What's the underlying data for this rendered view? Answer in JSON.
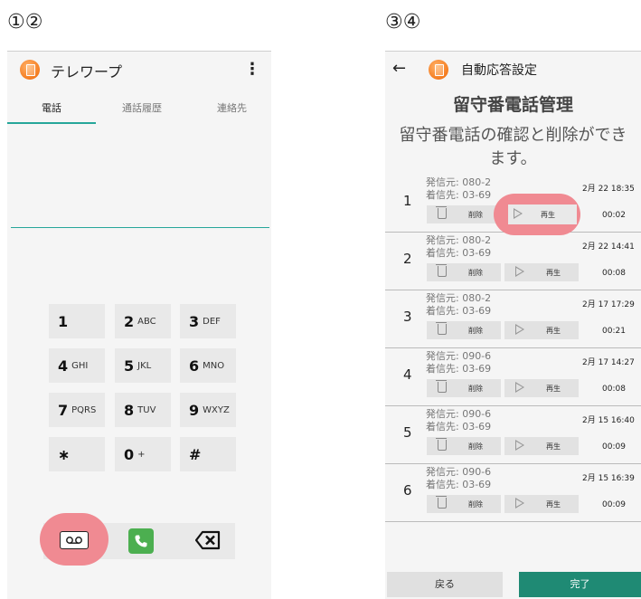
{
  "steps": {
    "s1": "①②",
    "s2": "③④"
  },
  "phone1": {
    "title": "テレワープ",
    "menu_glyph": "⋮",
    "tabs": [
      "電話",
      "通話履歴",
      "連絡先"
    ],
    "keys": [
      {
        "d": "1",
        "l": ""
      },
      {
        "d": "2",
        "l": "ABC"
      },
      {
        "d": "3",
        "l": "DEF"
      },
      {
        "d": "4",
        "l": "GHI"
      },
      {
        "d": "5",
        "l": "JKL"
      },
      {
        "d": "6",
        "l": "MNO"
      },
      {
        "d": "7",
        "l": "PQRS"
      },
      {
        "d": "8",
        "l": "TUV"
      },
      {
        "d": "9",
        "l": "WXYZ"
      },
      {
        "d": "∗",
        "l": ""
      },
      {
        "d": "0",
        "l": "+"
      },
      {
        "d": "#",
        "l": ""
      }
    ],
    "icons": {
      "voicemail": "voicemail-icon",
      "call": "phone-icon",
      "backspace": "backspace-icon"
    },
    "colors": {
      "accent": "#26a69a",
      "call": "#4caf50",
      "highlight": "#f08a92"
    }
  },
  "phone2": {
    "back_glyph": "←",
    "title": "自動応答設定",
    "heading": "留守番電話管理",
    "desc_line1": "留守番電話の確認と削除ができ",
    "desc_line2": "ます。",
    "delete_label": "削除",
    "play_label": "再生",
    "entries": [
      {
        "num": "1",
        "from": "発信元: 080-2",
        "to": "着信先: 03-69",
        "date": "2月 22 18:35",
        "dur": "00:02"
      },
      {
        "num": "2",
        "from": "発信元: 080-2",
        "to": "着信先: 03-69",
        "date": "2月 22 14:41",
        "dur": "00:08"
      },
      {
        "num": "3",
        "from": "発信元: 080-2",
        "to": "着信先: 03-69",
        "date": "2月 17 17:29",
        "dur": "00:21"
      },
      {
        "num": "4",
        "from": "発信元: 090-6",
        "to": "着信先: 03-69",
        "date": "2月 17 14:27",
        "dur": "00:08"
      },
      {
        "num": "5",
        "from": "発信元: 090-6",
        "to": "着信先: 03-69",
        "date": "2月 15 16:40",
        "dur": "00:09"
      },
      {
        "num": "6",
        "from": "発信元: 090-6",
        "to": "着信先: 03-69",
        "date": "2月 15 16:39",
        "dur": "00:09"
      }
    ],
    "back_button": "戻る",
    "done_button": "完了",
    "colors": {
      "done": "#1f8a74",
      "highlight": "#f08a92"
    }
  }
}
